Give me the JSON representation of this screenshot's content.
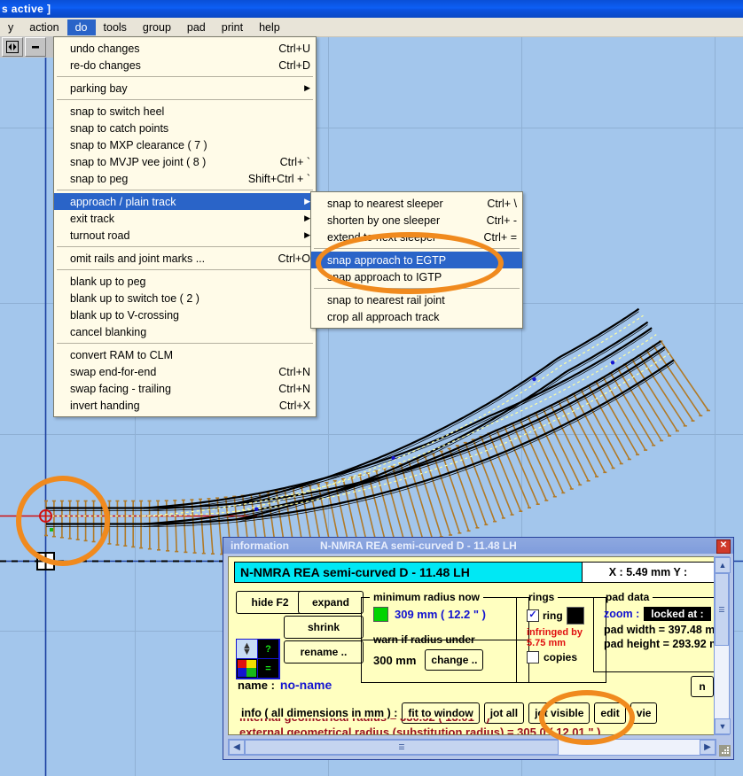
{
  "window": {
    "title": "s  active  ]",
    "titlebar_color": "#0d5ff5"
  },
  "menubar": {
    "items": [
      {
        "label": "y",
        "selected": false
      },
      {
        "label": "action",
        "selected": false
      },
      {
        "label": "do",
        "selected": true
      },
      {
        "label": "tools",
        "selected": false
      },
      {
        "label": "group",
        "selected": false
      },
      {
        "label": "pad",
        "selected": false
      },
      {
        "label": "print",
        "selected": false
      },
      {
        "label": "help",
        "selected": false
      }
    ]
  },
  "toolbar": {
    "buttons": [
      {
        "name": "expand-collapse-icon",
        "glyph": "◀▶"
      },
      {
        "name": "minimize-icon",
        "glyph": "—"
      }
    ]
  },
  "do_menu": {
    "groups": [
      {
        "items": [
          {
            "label": "undo changes",
            "accel": "Ctrl+U",
            "arrow": false,
            "selected": false
          },
          {
            "label": "re-do changes",
            "accel": "Ctrl+D",
            "arrow": false,
            "selected": false
          }
        ]
      },
      {
        "items": [
          {
            "label": "parking bay",
            "accel": "",
            "arrow": true,
            "selected": false
          }
        ]
      },
      {
        "items": [
          {
            "label": "snap to switch heel",
            "accel": "",
            "arrow": false,
            "selected": false
          },
          {
            "label": "snap to catch points",
            "accel": "",
            "arrow": false,
            "selected": false
          },
          {
            "label": "snap to MXP clearance  ( 7 )",
            "accel": "",
            "arrow": false,
            "selected": false
          },
          {
            "label": "snap to MVJP vee joint ( 8 )",
            "accel": "Ctrl+ `",
            "arrow": false,
            "selected": false
          },
          {
            "label": "snap to peg",
            "accel": "Shift+Ctrl + `",
            "arrow": false,
            "selected": false
          }
        ]
      },
      {
        "items": [
          {
            "label": "approach / plain  track",
            "accel": "",
            "arrow": true,
            "selected": true
          },
          {
            "label": "exit track",
            "accel": "",
            "arrow": true,
            "selected": false
          },
          {
            "label": "turnout road",
            "accel": "",
            "arrow": true,
            "selected": false
          }
        ]
      },
      {
        "items": [
          {
            "label": "omit rails and joint marks ...",
            "accel": "Ctrl+O",
            "arrow": false,
            "selected": false
          }
        ]
      },
      {
        "items": [
          {
            "label": "blank up to peg",
            "accel": "",
            "arrow": false,
            "selected": false
          },
          {
            "label": "blank up to switch toe ( 2 )",
            "accel": "",
            "arrow": false,
            "selected": false
          },
          {
            "label": "blank up to V-crossing",
            "accel": "",
            "arrow": false,
            "selected": false
          },
          {
            "label": "cancel blanking",
            "accel": "",
            "arrow": false,
            "selected": false
          }
        ]
      },
      {
        "items": [
          {
            "label": "convert RAM to CLM",
            "accel": "",
            "arrow": false,
            "selected": false
          },
          {
            "label": "swap end-for-end",
            "accel": "Ctrl+N",
            "arrow": false,
            "selected": false
          },
          {
            "label": "swap facing - trailing",
            "accel": "Ctrl+N",
            "arrow": false,
            "selected": false
          },
          {
            "label": "invert handing",
            "accel": "Ctrl+X",
            "arrow": false,
            "selected": false
          }
        ]
      }
    ]
  },
  "sub_menu": {
    "groups": [
      {
        "items": [
          {
            "label": "snap to nearest sleeper",
            "accel": "Ctrl+ \\",
            "selected": false
          },
          {
            "label": "shorten by one sleeper",
            "accel": "Ctrl+ -",
            "selected": false
          },
          {
            "label": "extend to next sleeper",
            "accel": "Ctrl+ =",
            "selected": false
          }
        ]
      },
      {
        "items": [
          {
            "label": "snap approach to EGTP",
            "accel": "",
            "selected": true
          },
          {
            "label": "snap approach to IGTP",
            "accel": "",
            "selected": false
          }
        ]
      },
      {
        "items": [
          {
            "label": "snap to nearest rail joint",
            "accel": "",
            "selected": false
          },
          {
            "label": "crop all approach track",
            "accel": "",
            "selected": false
          }
        ]
      }
    ]
  },
  "info_dialog": {
    "titlebar": {
      "title": "information",
      "subtitle": "N-NMRA  REA semi-curved  D -  11.48   LH",
      "close_label": "✕"
    },
    "headline": "N-NMRA  REA semi-curved  D -  11.48   LH",
    "coords": "X : 5.49 mm      Y :",
    "buttons": {
      "hide": "hide  F2",
      "expand": "expand",
      "shrink": "shrink",
      "rename": "rename ..",
      "change": "change ..",
      "fit_to_window": "fit  to  window",
      "jot_all": "jot  all",
      "jot_visible": "jot  visible",
      "edit": "edit",
      "view": "vie"
    },
    "minimum_radius": {
      "legend": "minimum  radius  now",
      "swatch_color": "#00d400",
      "value": "309 mm ( 12.2 \" )"
    },
    "warn_radius": {
      "legend": "warn  if  radius  under",
      "value": "300 mm"
    },
    "rings": {
      "legend": "rings",
      "ring_label": "ring",
      "ring_checked": true,
      "infringed_line1": "infringed by",
      "infringed_line2": "5.75 mm",
      "copies_label": "copies",
      "copies_checked": false
    },
    "pad_data": {
      "legend": "pad  data",
      "zoom_label": "zoom :",
      "zoom_value": "locked  at :",
      "pad_width": "pad  width   =  397.48 m",
      "pad_height": "pad  height  =  293.92 m"
    },
    "name_label": "name :",
    "name_value": "no-name",
    "info_label": "info ( all  dimensions  in  mm ) :",
    "results": [
      "internal geometrical radius = 330.52 ( 13.01 \" )",
      "external geometrical radius (substitution radius) = 305.0    ( 12.01 \" )"
    ],
    "highlighted_value": "305.0"
  },
  "canvas": {
    "background_color": "#a3c6ec",
    "grid_color": "#8fb0d4",
    "axis_color": "#1b3fa0",
    "rail_color": "#000000",
    "sleeper_color": "#b07a28",
    "centreline_color": "#ffffa0",
    "annotation_color": "#f08a1e",
    "annotations": [
      {
        "name": "peg-highlight-ellipse"
      },
      {
        "name": "egtp-menu-highlight-ellipse"
      },
      {
        "name": "radius-value-highlight-ellipse"
      }
    ]
  }
}
